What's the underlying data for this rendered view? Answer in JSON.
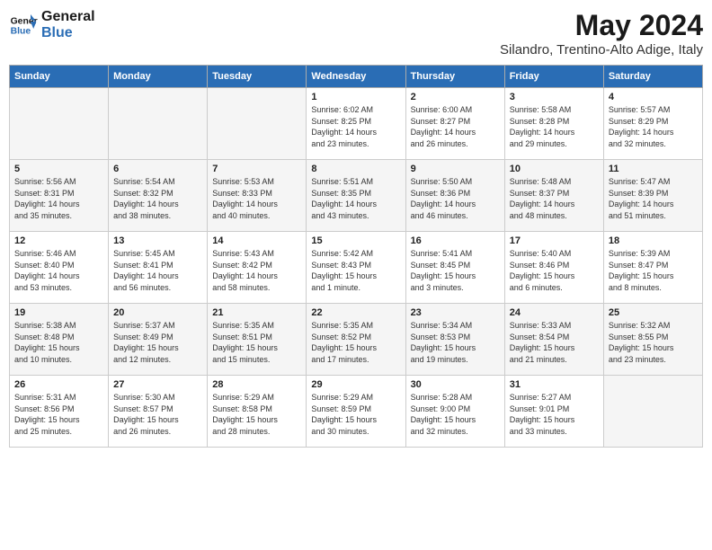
{
  "header": {
    "logo_line1": "General",
    "logo_line2": "Blue",
    "month_year": "May 2024",
    "location": "Silandro, Trentino-Alto Adige, Italy"
  },
  "weekdays": [
    "Sunday",
    "Monday",
    "Tuesday",
    "Wednesday",
    "Thursday",
    "Friday",
    "Saturday"
  ],
  "weeks": [
    [
      {
        "day": "",
        "info": ""
      },
      {
        "day": "",
        "info": ""
      },
      {
        "day": "",
        "info": ""
      },
      {
        "day": "1",
        "info": "Sunrise: 6:02 AM\nSunset: 8:25 PM\nDaylight: 14 hours\nand 23 minutes."
      },
      {
        "day": "2",
        "info": "Sunrise: 6:00 AM\nSunset: 8:27 PM\nDaylight: 14 hours\nand 26 minutes."
      },
      {
        "day": "3",
        "info": "Sunrise: 5:58 AM\nSunset: 8:28 PM\nDaylight: 14 hours\nand 29 minutes."
      },
      {
        "day": "4",
        "info": "Sunrise: 5:57 AM\nSunset: 8:29 PM\nDaylight: 14 hours\nand 32 minutes."
      }
    ],
    [
      {
        "day": "5",
        "info": "Sunrise: 5:56 AM\nSunset: 8:31 PM\nDaylight: 14 hours\nand 35 minutes."
      },
      {
        "day": "6",
        "info": "Sunrise: 5:54 AM\nSunset: 8:32 PM\nDaylight: 14 hours\nand 38 minutes."
      },
      {
        "day": "7",
        "info": "Sunrise: 5:53 AM\nSunset: 8:33 PM\nDaylight: 14 hours\nand 40 minutes."
      },
      {
        "day": "8",
        "info": "Sunrise: 5:51 AM\nSunset: 8:35 PM\nDaylight: 14 hours\nand 43 minutes."
      },
      {
        "day": "9",
        "info": "Sunrise: 5:50 AM\nSunset: 8:36 PM\nDaylight: 14 hours\nand 46 minutes."
      },
      {
        "day": "10",
        "info": "Sunrise: 5:48 AM\nSunset: 8:37 PM\nDaylight: 14 hours\nand 48 minutes."
      },
      {
        "day": "11",
        "info": "Sunrise: 5:47 AM\nSunset: 8:39 PM\nDaylight: 14 hours\nand 51 minutes."
      }
    ],
    [
      {
        "day": "12",
        "info": "Sunrise: 5:46 AM\nSunset: 8:40 PM\nDaylight: 14 hours\nand 53 minutes."
      },
      {
        "day": "13",
        "info": "Sunrise: 5:45 AM\nSunset: 8:41 PM\nDaylight: 14 hours\nand 56 minutes."
      },
      {
        "day": "14",
        "info": "Sunrise: 5:43 AM\nSunset: 8:42 PM\nDaylight: 14 hours\nand 58 minutes."
      },
      {
        "day": "15",
        "info": "Sunrise: 5:42 AM\nSunset: 8:43 PM\nDaylight: 15 hours\nand 1 minute."
      },
      {
        "day": "16",
        "info": "Sunrise: 5:41 AM\nSunset: 8:45 PM\nDaylight: 15 hours\nand 3 minutes."
      },
      {
        "day": "17",
        "info": "Sunrise: 5:40 AM\nSunset: 8:46 PM\nDaylight: 15 hours\nand 6 minutes."
      },
      {
        "day": "18",
        "info": "Sunrise: 5:39 AM\nSunset: 8:47 PM\nDaylight: 15 hours\nand 8 minutes."
      }
    ],
    [
      {
        "day": "19",
        "info": "Sunrise: 5:38 AM\nSunset: 8:48 PM\nDaylight: 15 hours\nand 10 minutes."
      },
      {
        "day": "20",
        "info": "Sunrise: 5:37 AM\nSunset: 8:49 PM\nDaylight: 15 hours\nand 12 minutes."
      },
      {
        "day": "21",
        "info": "Sunrise: 5:35 AM\nSunset: 8:51 PM\nDaylight: 15 hours\nand 15 minutes."
      },
      {
        "day": "22",
        "info": "Sunrise: 5:35 AM\nSunset: 8:52 PM\nDaylight: 15 hours\nand 17 minutes."
      },
      {
        "day": "23",
        "info": "Sunrise: 5:34 AM\nSunset: 8:53 PM\nDaylight: 15 hours\nand 19 minutes."
      },
      {
        "day": "24",
        "info": "Sunrise: 5:33 AM\nSunset: 8:54 PM\nDaylight: 15 hours\nand 21 minutes."
      },
      {
        "day": "25",
        "info": "Sunrise: 5:32 AM\nSunset: 8:55 PM\nDaylight: 15 hours\nand 23 minutes."
      }
    ],
    [
      {
        "day": "26",
        "info": "Sunrise: 5:31 AM\nSunset: 8:56 PM\nDaylight: 15 hours\nand 25 minutes."
      },
      {
        "day": "27",
        "info": "Sunrise: 5:30 AM\nSunset: 8:57 PM\nDaylight: 15 hours\nand 26 minutes."
      },
      {
        "day": "28",
        "info": "Sunrise: 5:29 AM\nSunset: 8:58 PM\nDaylight: 15 hours\nand 28 minutes."
      },
      {
        "day": "29",
        "info": "Sunrise: 5:29 AM\nSunset: 8:59 PM\nDaylight: 15 hours\nand 30 minutes."
      },
      {
        "day": "30",
        "info": "Sunrise: 5:28 AM\nSunset: 9:00 PM\nDaylight: 15 hours\nand 32 minutes."
      },
      {
        "day": "31",
        "info": "Sunrise: 5:27 AM\nSunset: 9:01 PM\nDaylight: 15 hours\nand 33 minutes."
      },
      {
        "day": "",
        "info": ""
      }
    ]
  ]
}
